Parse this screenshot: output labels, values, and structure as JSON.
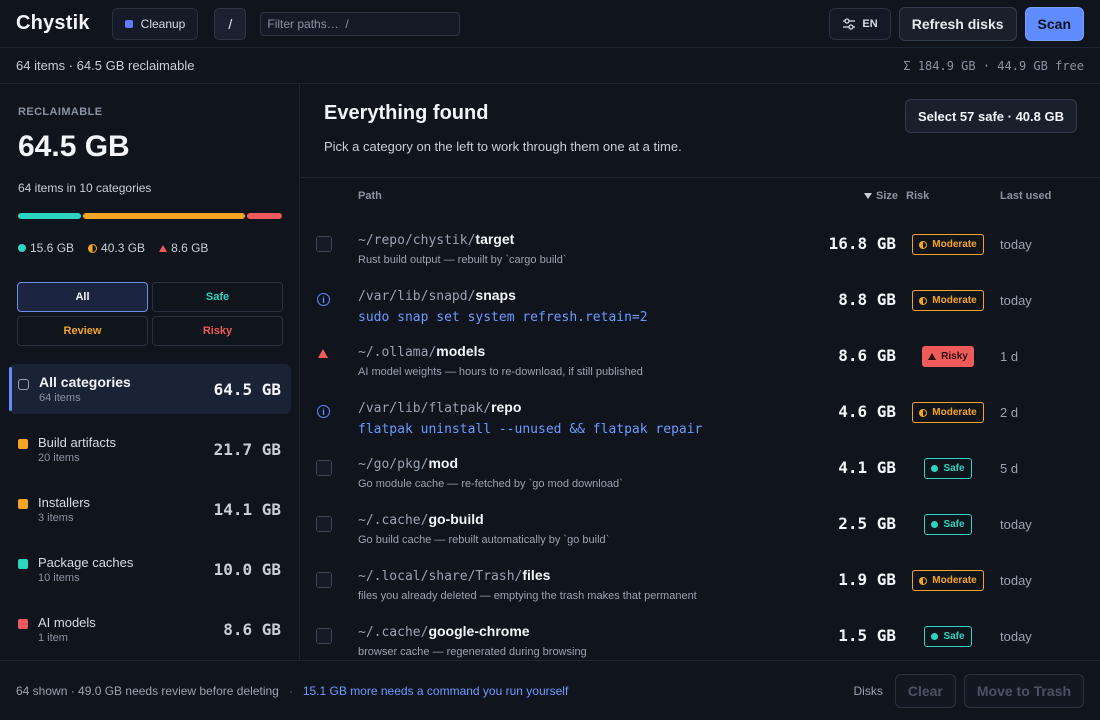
{
  "app": {
    "title": "Chystik"
  },
  "topbar": {
    "mode_label": "Cleanup",
    "root_label": "/",
    "filter_placeholder": "Filter paths…  /",
    "lang_label": "EN",
    "refresh_label": "Refresh disks",
    "scan_label": "Scan"
  },
  "summary": {
    "left": "64 items · 64.5 GB reclaimable",
    "right": "Σ 184.9 GB · 44.9 GB free"
  },
  "sidebar": {
    "reclaimable_label": "RECLAIMABLE",
    "total": "64.5 GB",
    "subtitle": "64 items in 10 categories",
    "bar": [
      {
        "risk": "safe",
        "gb": 15.6,
        "color": "#2dd4bf"
      },
      {
        "risk": "moderate",
        "gb": 40.3,
        "color": "#f5a524"
      },
      {
        "risk": "risky",
        "gb": 8.6,
        "color": "#ef5a5a"
      }
    ],
    "legend": {
      "safe": "15.6 GB",
      "moderate": "40.3 GB",
      "risky": "8.6 GB"
    },
    "filters": [
      {
        "label": "All",
        "color": "#f3f5f9",
        "active": true
      },
      {
        "label": "Safe",
        "color": "#2dd4bf",
        "active": false
      },
      {
        "label": "Review",
        "color": "#f5a524",
        "active": false
      },
      {
        "label": "Risky",
        "color": "#ef5a5a",
        "active": false
      }
    ],
    "categories": [
      {
        "name": "All categories",
        "count": "64 items",
        "size": "64.5 GB",
        "color": "",
        "active": true
      },
      {
        "name": "Build artifacts",
        "count": "20 items",
        "size": "21.7 GB",
        "color": "#f5a524",
        "active": false
      },
      {
        "name": "Installers",
        "count": "3 items",
        "size": "14.1 GB",
        "color": "#f5a524",
        "active": false
      },
      {
        "name": "Package caches",
        "count": "10 items",
        "size": "10.0 GB",
        "color": "#2dd4bf",
        "active": false
      },
      {
        "name": "AI models",
        "count": "1 item",
        "size": "8.6 GB",
        "color": "#ef5a5a",
        "active": false
      }
    ]
  },
  "main": {
    "title": "Everything found",
    "subtitle": "Pick a category on the left to work through them one at a time.",
    "select_safe_label": "Select 57 safe · 40.8 GB",
    "columns": {
      "path": "Path",
      "size": "Size",
      "risk": "Risk",
      "last_used": "Last used"
    },
    "rows": [
      {
        "marker": "checkbox",
        "prefix": "~/repo/chystik/",
        "name": "target",
        "detail": "Rust build output — rebuilt by `cargo build`",
        "detail_is_command": false,
        "size": "16.8 GB",
        "risk": "Moderate",
        "last_used": "today"
      },
      {
        "marker": "info",
        "prefix": "/var/lib/snapd/",
        "name": "snaps",
        "detail": "sudo snap set system refresh.retain=2",
        "detail_is_command": true,
        "size": "8.8 GB",
        "risk": "Moderate",
        "last_used": "today"
      },
      {
        "marker": "warning",
        "prefix": "~/.ollama/",
        "name": "models",
        "detail": "AI model weights — hours to re-download, if still published",
        "detail_is_command": false,
        "size": "8.6 GB",
        "risk": "Risky",
        "last_used": "1 d"
      },
      {
        "marker": "info",
        "prefix": "/var/lib/flatpak/",
        "name": "repo",
        "detail": "flatpak uninstall --unused && flatpak repair",
        "detail_is_command": true,
        "size": "4.6 GB",
        "risk": "Moderate",
        "last_used": "2 d"
      },
      {
        "marker": "checkbox",
        "prefix": "~/go/pkg/",
        "name": "mod",
        "detail": "Go module cache — re-fetched by `go mod download`",
        "detail_is_command": false,
        "size": "4.1 GB",
        "risk": "Safe",
        "last_used": "5 d"
      },
      {
        "marker": "checkbox",
        "prefix": "~/.cache/",
        "name": "go-build",
        "detail": "Go build cache — rebuilt automatically by `go build`",
        "detail_is_command": false,
        "size": "2.5 GB",
        "risk": "Safe",
        "last_used": "today"
      },
      {
        "marker": "checkbox",
        "prefix": "~/.local/share/Trash/",
        "name": "files",
        "detail": "files you already deleted — emptying the trash makes that permanent",
        "detail_is_command": false,
        "size": "1.9 GB",
        "risk": "Moderate",
        "last_used": "today"
      },
      {
        "marker": "checkbox",
        "prefix": "~/.cache/",
        "name": "google-chrome",
        "detail": "browser cache — regenerated during browsing",
        "detail_is_command": false,
        "size": "1.5 GB",
        "risk": "Safe",
        "last_used": "today"
      }
    ]
  },
  "footer": {
    "left": "64 shown · 49.0 GB needs review before deleting",
    "separator": "·",
    "link": "15.1 GB more needs a command you run yourself",
    "disks_label": "Disks",
    "clear_label": "Clear",
    "trash_label": "Move to Trash"
  }
}
